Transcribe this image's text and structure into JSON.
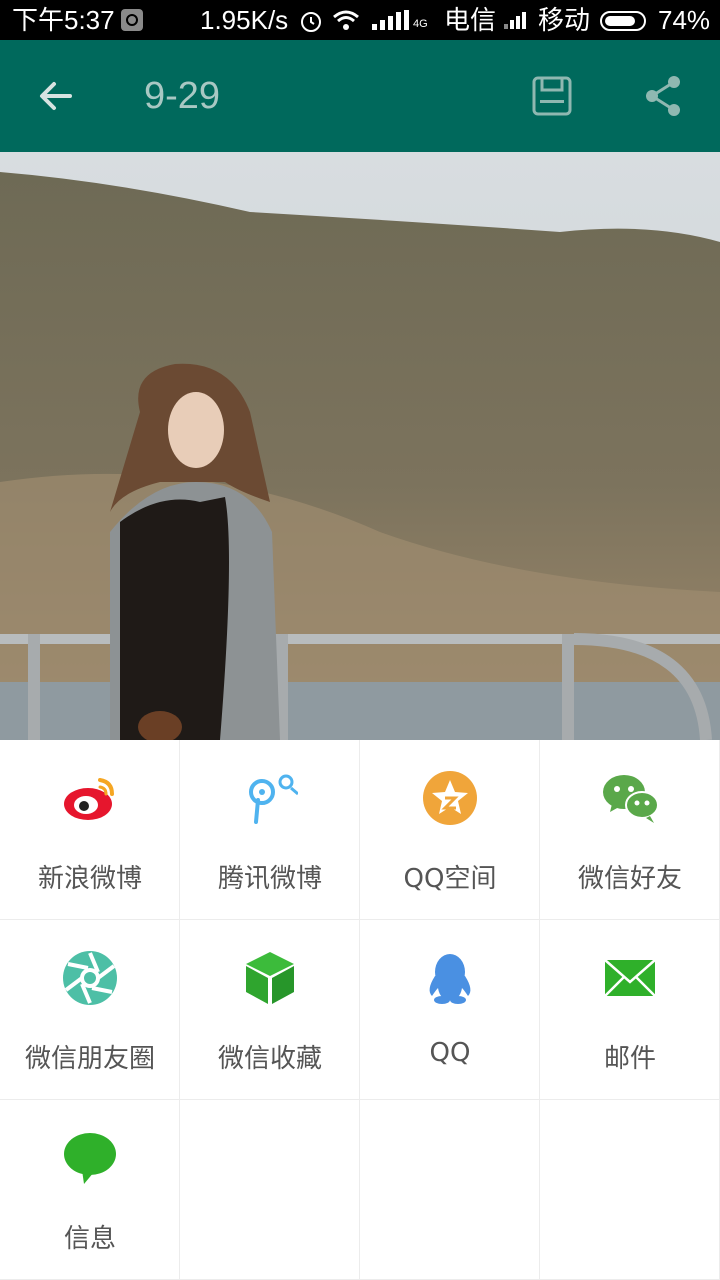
{
  "status_bar": {
    "time": "下午5:37",
    "speed": "1.95K/s",
    "network_top": "4G",
    "network_bottom": "1X",
    "carrier1": "电信",
    "carrier2": "移动",
    "battery": "74%"
  },
  "app_bar": {
    "title": "9-29",
    "back_icon": "arrow-back-icon",
    "save_icon": "save-icon",
    "share_icon": "share-icon",
    "color": "#00695c"
  },
  "share_targets": [
    {
      "label": "新浪微博",
      "icon": "weibo-icon",
      "color": "#e6162d"
    },
    {
      "label": "腾讯微博",
      "icon": "tencent-weibo-icon",
      "color": "#4fb3ef"
    },
    {
      "label": "QQ空间",
      "icon": "qzone-icon",
      "color": "#f0a53a"
    },
    {
      "label": "微信好友",
      "icon": "wechat-icon",
      "color": "#5aa84a"
    },
    {
      "label": "微信朋友圈",
      "icon": "wechat-moments-icon",
      "color": "#4dbfa6"
    },
    {
      "label": "微信收藏",
      "icon": "wechat-favorites-icon",
      "color": "#2fa52e"
    },
    {
      "label": "QQ",
      "icon": "qq-icon",
      "color": "#4a90e2"
    },
    {
      "label": "邮件",
      "icon": "mail-icon",
      "color": "#2fb02a"
    },
    {
      "label": "信息",
      "icon": "message-icon",
      "color": "#2fb02a"
    }
  ]
}
